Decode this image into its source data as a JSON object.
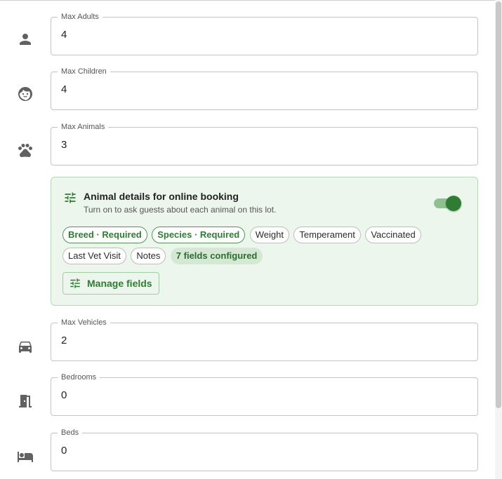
{
  "fields": {
    "max_adults": {
      "label": "Max Adults",
      "value": "4",
      "icon": "person-icon"
    },
    "max_children": {
      "label": "Max Children",
      "value": "4",
      "icon": "child-face-icon"
    },
    "max_animals": {
      "label": "Max Animals",
      "value": "3",
      "icon": "paw-icon"
    },
    "max_vehicles": {
      "label": "Max Vehicles",
      "value": "2",
      "icon": "car-icon"
    },
    "bedrooms": {
      "label": "Bedrooms",
      "value": "0",
      "icon": "door-icon"
    },
    "beds": {
      "label": "Beds",
      "value": "0",
      "icon": "bed-icon"
    }
  },
  "animal_details": {
    "title": "Animal details for online booking",
    "subtitle": "Turn on to ask guests about each animal on this lot.",
    "toggle_on": true,
    "icon": "tune-icon",
    "chips": [
      {
        "label": "Breed · Required",
        "required": true
      },
      {
        "label": "Species · Required",
        "required": true
      },
      {
        "label": "Weight",
        "required": false
      },
      {
        "label": "Temperament",
        "required": false
      },
      {
        "label": "Vaccinated",
        "required": false
      },
      {
        "label": "Last Vet Visit",
        "required": false
      },
      {
        "label": "Notes",
        "required": false
      }
    ],
    "count_label": "7 fields configured",
    "manage_button": "Manage fields"
  },
  "colors": {
    "accent": "#2e7d32",
    "card_background": "#edf6ec",
    "field_border": "#c4c4c4",
    "icon_gray": "#616161"
  }
}
